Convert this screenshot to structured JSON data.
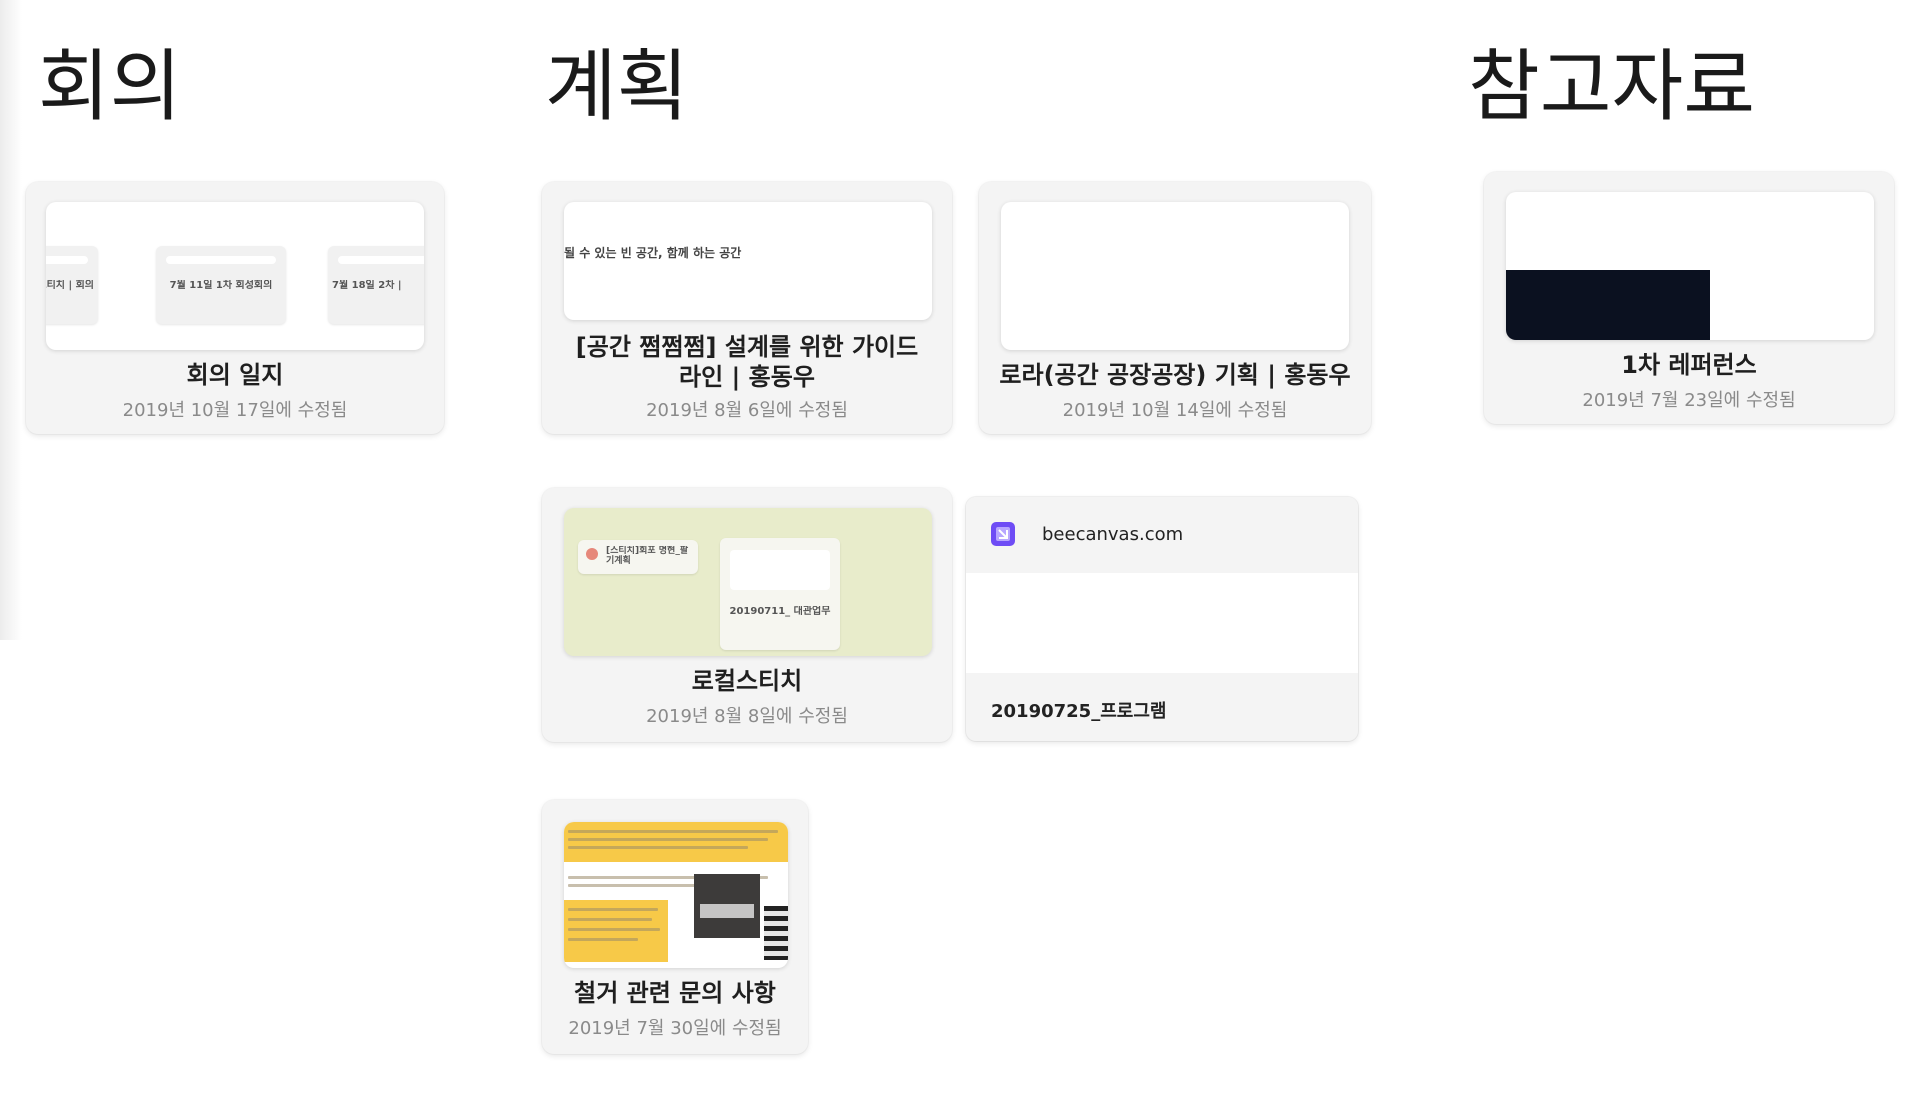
{
  "sections": {
    "meeting": {
      "heading": "회의"
    },
    "plan": {
      "heading": "계획"
    },
    "reference": {
      "heading": "참고자료"
    }
  },
  "cards": {
    "meeting_log": {
      "title": "회의 일지",
      "date": "2019년 10월 17일에 수정됨",
      "thumb_items": [
        "컬스티치 | 회의",
        "7월 11일 1차 회성회의",
        "7월 18일 2차 |"
      ]
    },
    "guideline": {
      "title": "[공간 쩜쩜쩜] 설계를 위한 가이드라인 | 홍동우",
      "date": "2019년 8월 6일에 수정됨",
      "thumb_text": "될 수 있는 빈 공간, 함께 하는 공간"
    },
    "lora": {
      "title": "로라(공간 공장공장) 기획 | 홍동우",
      "date": "2019년 10월 14일에 수정됨"
    },
    "local_stitch": {
      "title": "로컬스티치",
      "date": "2019년 8월 8일에 수정됨",
      "thumb_items": [
        "[스티치]회포 명현_팔기계획",
        "20190711_ 대관업무"
      ]
    },
    "program_link": {
      "domain": "beecanvas.com",
      "title": "20190725_프로그램"
    },
    "demolition": {
      "title": "철거 관련 문의 사항",
      "date": "2019년 7월 30일에 수정됨"
    },
    "first_reference": {
      "title": "1차 레퍼런스",
      "date": "2019년 7월 23일에 수정됨"
    }
  },
  "colors": {
    "card_bg": "#f4f4f4",
    "green_thumb": "#e8eccb",
    "yellow_block": "#f7c948",
    "brand_purple": "#6e4cf5",
    "date_gray": "#8a8a8a"
  }
}
